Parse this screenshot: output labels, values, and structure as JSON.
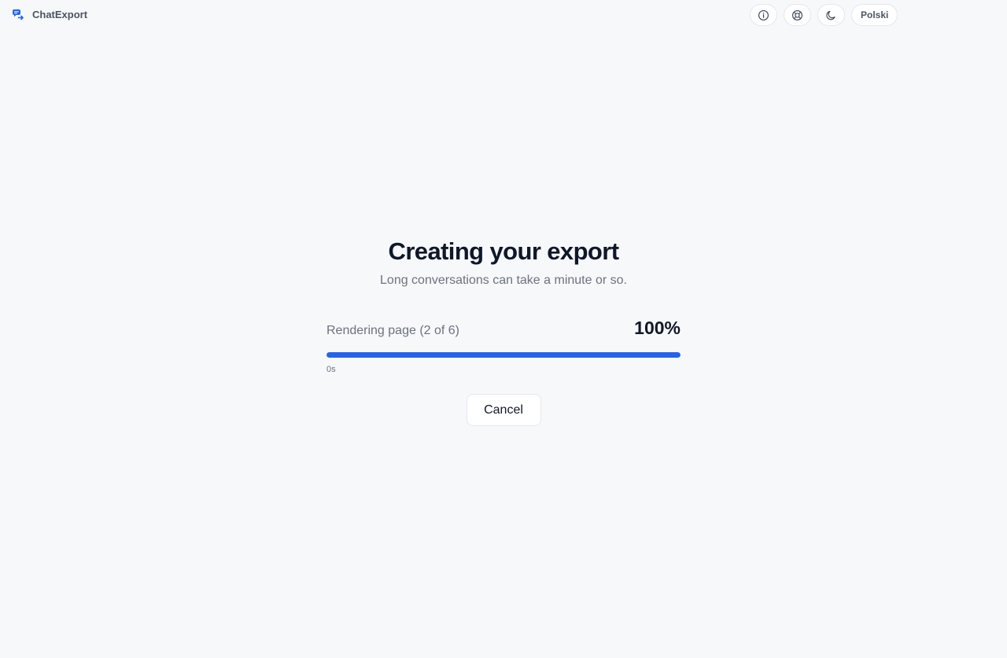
{
  "app": {
    "name": "ChatExport",
    "logo_icon": "chat-export-logo-icon",
    "accent_color": "#2563eb"
  },
  "header": {
    "actions": [
      {
        "icon": "info-icon"
      },
      {
        "icon": "lifebuoy-icon"
      },
      {
        "icon": "moon-icon"
      }
    ],
    "language_label": "Polski"
  },
  "export": {
    "title": "Creating your export",
    "subtitle": "Long conversations can take a minute or so.",
    "status": "Rendering page (2 of 6)",
    "percent_label": "100%",
    "progress": 1.0,
    "elapsed": "0s",
    "cancel_label": "Cancel"
  }
}
